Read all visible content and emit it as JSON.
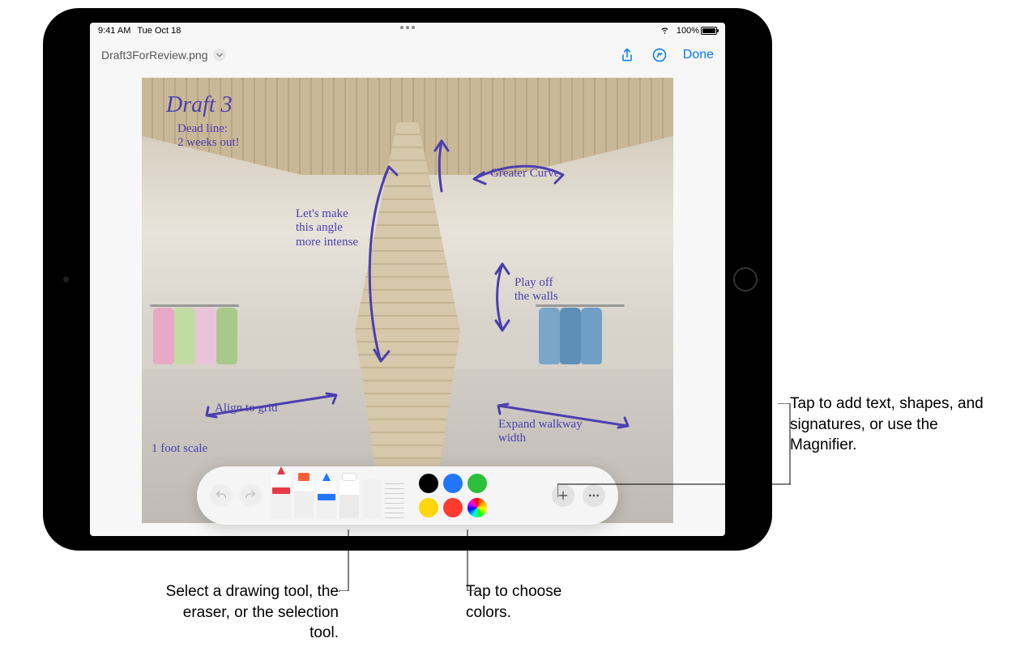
{
  "status": {
    "time": "9:41 AM",
    "date": "Tue Oct 18",
    "battery_pct": "100%"
  },
  "nav": {
    "filename": "Draft3ForReview.png",
    "done_label": "Done"
  },
  "annotations": {
    "title": "Draft 3",
    "deadline": "Dead line:\n2 weeks out!",
    "angle": "Let's make\nthis angle\nmore intense",
    "curve": "Greater Curve",
    "walls": "Play off\nthe walls",
    "align": "Align to grid",
    "scale": "1 foot scale",
    "walkway": "Expand walkway\nwidth"
  },
  "toolbar": {
    "tools": [
      "pen",
      "marker",
      "pencil",
      "eraser",
      "lasso",
      "ruler"
    ],
    "pen_color": "#e63946",
    "marker_color": "#ffbe0b",
    "pencil_color": "#2176ff",
    "colors": {
      "black": "#000000",
      "blue": "#2176ff",
      "green": "#2bbf3a",
      "yellow": "#ffd60a",
      "red": "#ff3b30"
    }
  },
  "callouts": {
    "tools": "Select a drawing tool, the eraser, or the selection tool.",
    "colors": "Tap to choose colors.",
    "add": "Tap to add text, shapes, and signatures, or use the Magnifier."
  }
}
